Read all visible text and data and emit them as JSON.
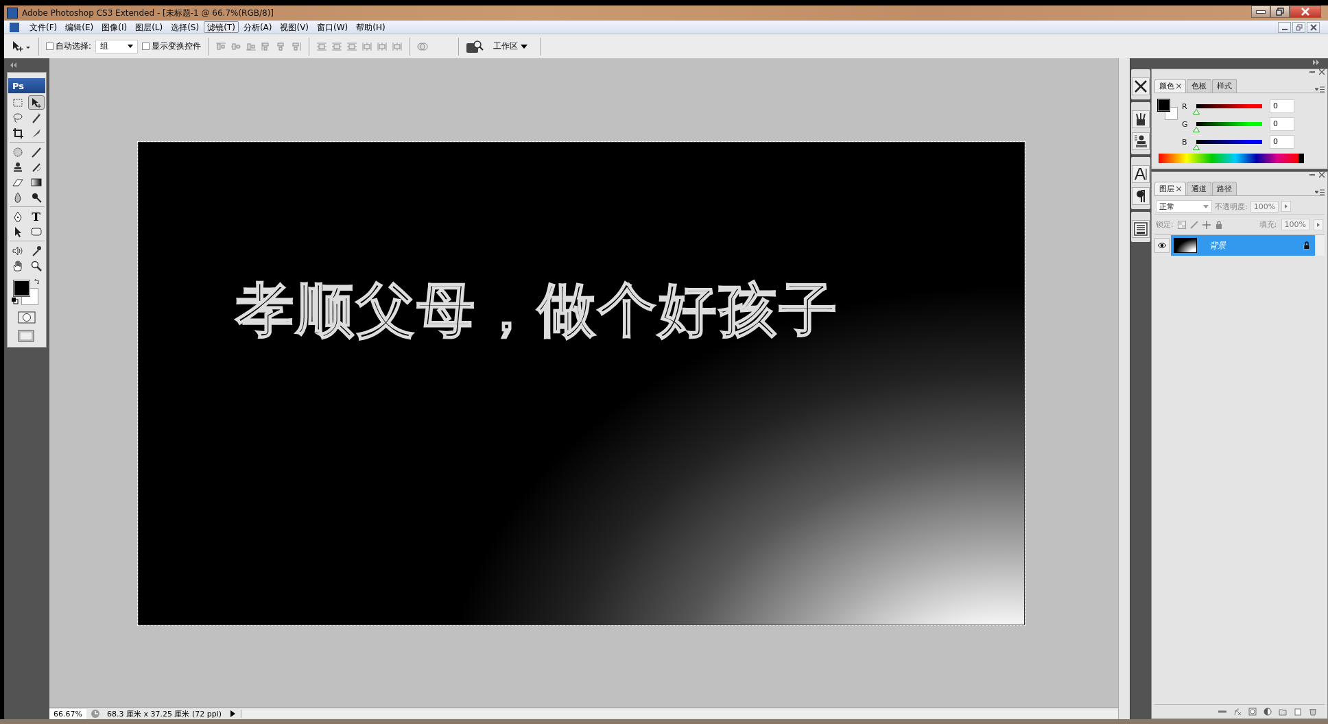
{
  "window": {
    "title": "Adobe Photoshop CS3 Extended - [未标题-1 @ 66.7%(RGB/8)]"
  },
  "menu": [
    {
      "label": "文件(F)",
      "selected": false
    },
    {
      "label": "编辑(E)",
      "selected": false
    },
    {
      "label": "图像(I)",
      "selected": false
    },
    {
      "label": "图层(L)",
      "selected": false
    },
    {
      "label": "选择(S)",
      "selected": false
    },
    {
      "label": "滤镜(T)",
      "selected": true
    },
    {
      "label": "分析(A)",
      "selected": false
    },
    {
      "label": "视图(V)",
      "selected": false
    },
    {
      "label": "窗口(W)",
      "selected": false
    },
    {
      "label": "帮助(H)",
      "selected": false
    }
  ],
  "options_bar": {
    "auto_select": {
      "label": "自动选择:",
      "checked": false
    },
    "auto_select_mode": "组",
    "show_transform": {
      "label": "显示变换控件",
      "checked": false
    },
    "workspace": "工作区"
  },
  "toolbox": {
    "logo": "Ps",
    "tools": [
      {
        "kind": "marquee",
        "selected": false
      },
      {
        "kind": "move",
        "selected": true
      },
      {
        "kind": "lasso",
        "selected": false
      },
      {
        "kind": "wand",
        "selected": false
      },
      {
        "kind": "crop",
        "selected": false
      },
      {
        "kind": "slice",
        "selected": false
      },
      {
        "kind": "heal",
        "selected": false
      },
      {
        "kind": "brush",
        "selected": false
      },
      {
        "kind": "stamp",
        "selected": false
      },
      {
        "kind": "history",
        "selected": false
      },
      {
        "kind": "eraser",
        "selected": false
      },
      {
        "kind": "gradient",
        "selected": false
      },
      {
        "kind": "blur",
        "selected": false
      },
      {
        "kind": "dodge",
        "selected": false
      },
      {
        "kind": "pen",
        "selected": false
      },
      {
        "kind": "type",
        "selected": false
      },
      {
        "kind": "select",
        "selected": false
      },
      {
        "kind": "shape",
        "selected": false
      },
      {
        "kind": "audio",
        "selected": false
      },
      {
        "kind": "eyedropper",
        "selected": false
      },
      {
        "kind": "hand",
        "selected": false
      },
      {
        "kind": "zoom",
        "selected": false
      }
    ],
    "type_glyph": "T"
  },
  "canvas": {
    "text": "孝顺父母，做个好孩子"
  },
  "color_panel": {
    "tabs": [
      {
        "label": "颜色",
        "selected": true
      },
      {
        "label": "色板",
        "selected": false
      },
      {
        "label": "样式",
        "selected": false
      }
    ],
    "channels": [
      {
        "name": "R",
        "value": "0",
        "level": 0,
        "color": "#ff0000"
      },
      {
        "name": "G",
        "value": "0",
        "level": 0,
        "color": "#00ff00"
      },
      {
        "name": "B",
        "value": "0",
        "level": 0,
        "color": "#0000ff"
      }
    ]
  },
  "layers_panel": {
    "tabs": [
      {
        "label": "图层",
        "selected": true
      },
      {
        "label": "通道",
        "selected": false
      },
      {
        "label": "路径",
        "selected": false
      }
    ],
    "blend_mode": "正常",
    "opacity_label": "不透明度:",
    "opacity": "100%",
    "lock_label": "锁定:",
    "fill_label": "填充:",
    "fill": "100%",
    "layers": [
      {
        "name": "背景",
        "visible": true,
        "selected": true,
        "locked": true
      }
    ]
  },
  "status_bar": {
    "zoom": "66.67%",
    "doc_info": "68.3 厘米 x 37.25 厘米 (72 ppi)"
  }
}
